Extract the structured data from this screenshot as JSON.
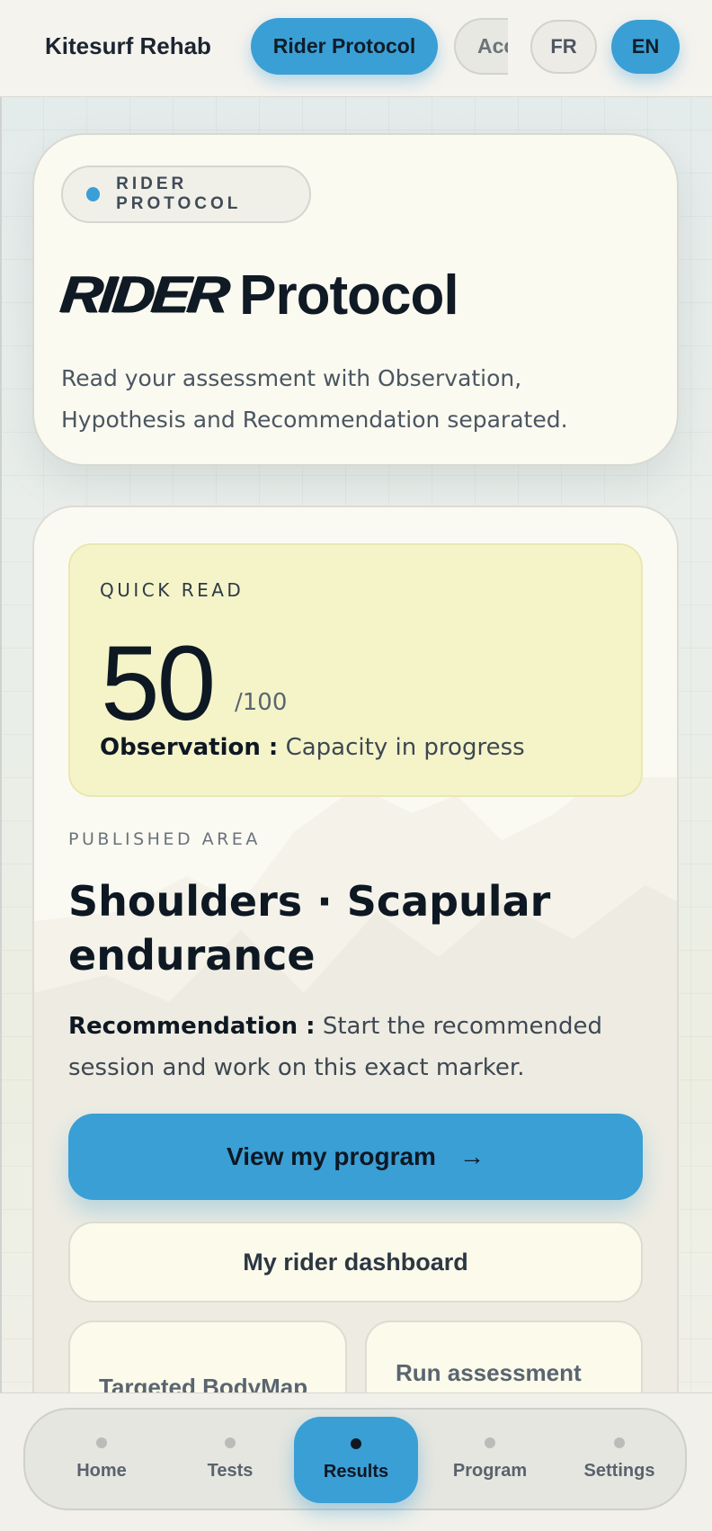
{
  "header": {
    "brand": "Kitesurf Rehab",
    "nav_active": "Rider Protocol",
    "nav_partial": "Acc",
    "lang_fr": "FR",
    "lang_en": "EN"
  },
  "hero": {
    "kicker": "RIDER PROTOCOL",
    "title_script": "Rider",
    "title_main": "Protocol",
    "subtitle": "Read your assessment with Observation, Hypothesis and Recommendation separated."
  },
  "quick_read": {
    "label": "QUICK READ",
    "score": "50",
    "max": "/100",
    "observation_label": "Observation :",
    "observation_value": "Capacity in progress"
  },
  "published": {
    "label": "PUBLISHED AREA",
    "title": "Shoulders · Scapular endurance",
    "recommendation_label": "Recommendation :",
    "recommendation_text": "Start the recommended session and work on this exact marker."
  },
  "actions": {
    "primary": "View my program",
    "primary_arrow": "→",
    "secondary": "My rider dashboard",
    "tile_a": "Targeted BodyMap",
    "tile_b": "Run assessment again"
  },
  "bottom_nav": {
    "items": [
      {
        "label": "Home"
      },
      {
        "label": "Tests"
      },
      {
        "label": "Results"
      },
      {
        "label": "Program"
      },
      {
        "label": "Settings"
      }
    ],
    "active": "Results"
  },
  "colors": {
    "accent": "#3a9fd5",
    "quick_read_bg": "#f5f4c9",
    "card_bg": "#fbfaf1"
  }
}
